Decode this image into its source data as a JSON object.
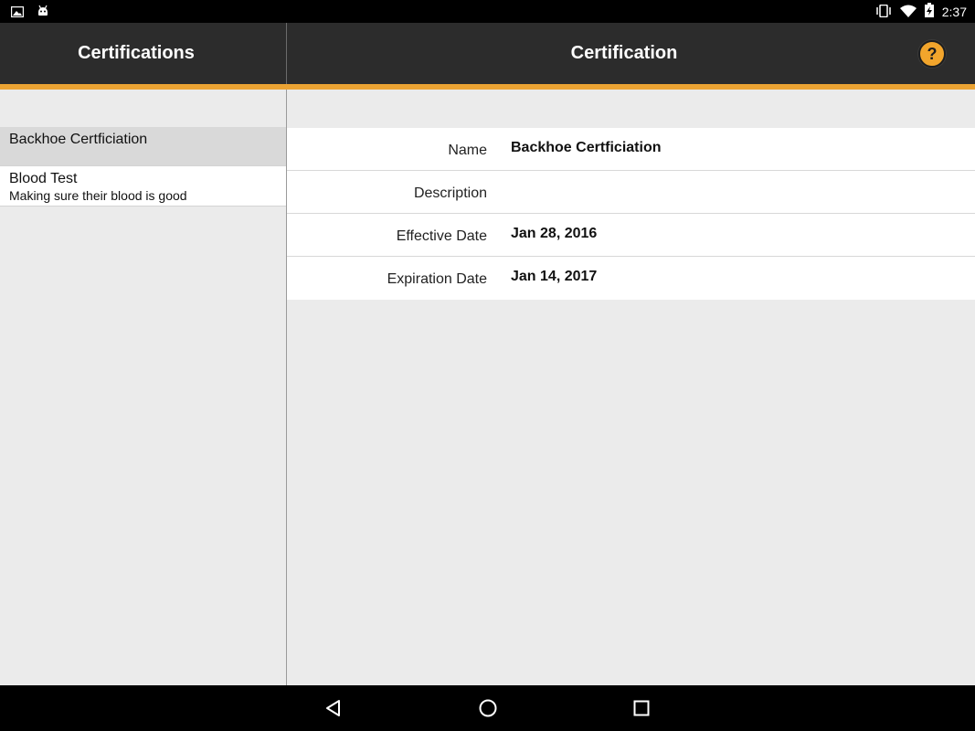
{
  "status_bar": {
    "time": "2:37",
    "icons": [
      "image-icon",
      "android-icon",
      "vibrate-icon",
      "wifi-icon",
      "battery-charging-icon"
    ]
  },
  "header": {
    "left_title": "Certifications",
    "right_title": "Certification",
    "help_label": "?",
    "accent_color": "#eba333",
    "bar_color": "#2c2c2c"
  },
  "list": {
    "items": [
      {
        "title": "Backhoe Certficiation",
        "subtitle": "",
        "selected": true
      },
      {
        "title": "Blood Test",
        "subtitle": "Making sure their blood is good",
        "selected": false
      }
    ]
  },
  "detail": {
    "fields": [
      {
        "label": "Name",
        "value": "Backhoe Certficiation"
      },
      {
        "label": "Description",
        "value": ""
      },
      {
        "label": "Effective Date",
        "value": "Jan 28, 2016"
      },
      {
        "label": "Expiration Date",
        "value": "Jan 14, 2017"
      }
    ]
  },
  "nav_bar": {
    "buttons": [
      "back-icon",
      "home-icon",
      "recents-icon"
    ]
  }
}
